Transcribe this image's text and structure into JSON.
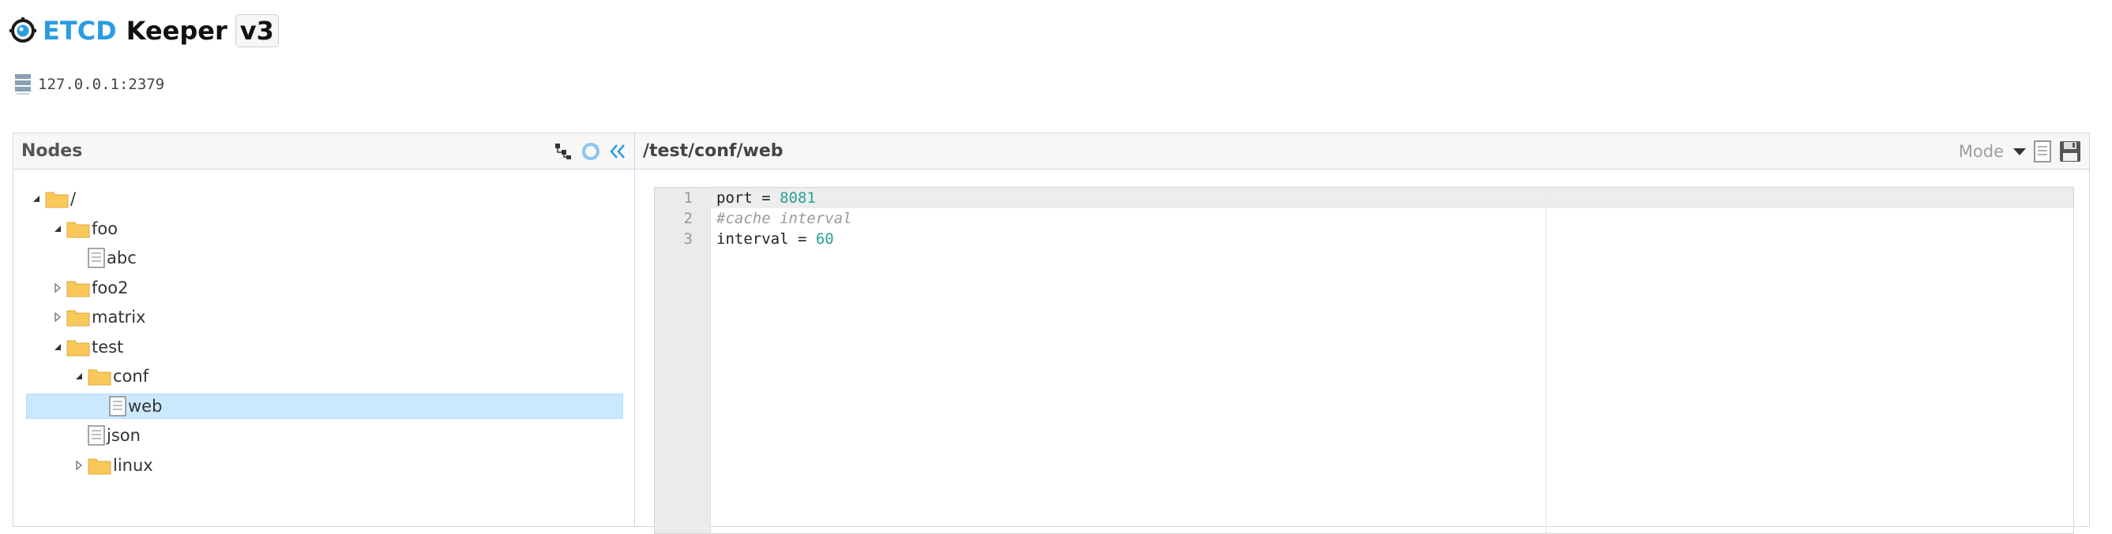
{
  "header": {
    "brand": "ETCD",
    "app_name": "Keeper",
    "version": "v3"
  },
  "host": {
    "address": "127.0.0.1:2379"
  },
  "nodes_panel": {
    "title": "Nodes",
    "tree": [
      {
        "label": "/",
        "type": "folder",
        "expanded": true
      },
      {
        "label": "foo",
        "type": "folder",
        "expanded": true
      },
      {
        "label": "abc",
        "type": "file"
      },
      {
        "label": "foo2",
        "type": "folder",
        "expanded": false
      },
      {
        "label": "matrix",
        "type": "folder",
        "expanded": false
      },
      {
        "label": "test",
        "type": "folder",
        "expanded": true
      },
      {
        "label": "conf",
        "type": "folder",
        "expanded": true
      },
      {
        "label": "web",
        "type": "file",
        "selected": true
      },
      {
        "label": "json",
        "type": "file"
      },
      {
        "label": "linux",
        "type": "folder",
        "expanded": false
      }
    ]
  },
  "editor_panel": {
    "path": "/test/conf/web",
    "mode_label": "Mode",
    "line_numbers": [
      "1",
      "2",
      "3"
    ],
    "lines": [
      {
        "key": "port",
        "op": " = ",
        "value": "8081"
      },
      {
        "comment": "#cache interval"
      },
      {
        "key": "interval",
        "op": " = ",
        "value": "60"
      }
    ]
  },
  "colors": {
    "brand_blue": "#2b9ce0",
    "selected_bg": "#cce8ff",
    "number": "#2aa198",
    "folder": "#f9c85a"
  }
}
